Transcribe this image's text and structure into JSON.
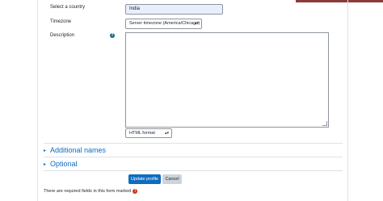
{
  "form": {
    "country_label": "Select a country",
    "country_value": "India",
    "timezone_label": "Timezone",
    "timezone_value": "Server timezone (America/Chicago)",
    "description_label": "Description",
    "description_value": "",
    "format_value": "HTML format"
  },
  "sections": [
    {
      "title": "Additional names"
    },
    {
      "title": "Optional"
    }
  ],
  "buttons": {
    "update_label": "Update profile",
    "cancel_label": "Cancel"
  },
  "footer": {
    "required_note": "There are required fields in this form marked"
  },
  "icons": {
    "help": "question-circle-icon",
    "required": "exclamation-circle-icon",
    "chevron": "chevron-right-icon",
    "caret": "sort-caret-icon"
  },
  "colors": {
    "link": "#0f6cbf",
    "primary_button": "#0f6cbf",
    "secondary_button": "#ced4da",
    "required_icon": "#ca3120",
    "help_icon": "#0f6e7e",
    "autofill_bg": "#e8eefb",
    "top_accent": "#8c3b3b"
  }
}
